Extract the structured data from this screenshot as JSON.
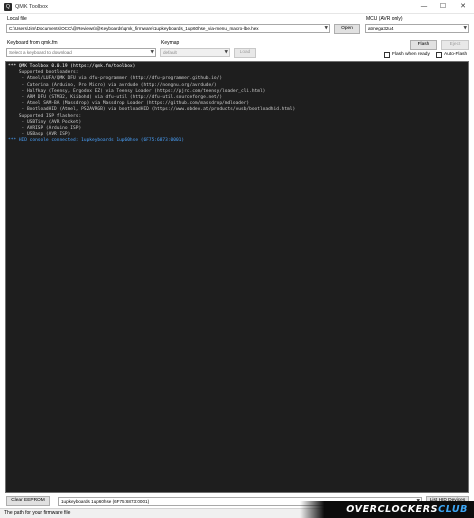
{
  "window": {
    "title": "QMK Toolbox",
    "icon_glyph": "Q",
    "controls": {
      "minimize": "—",
      "maximize": "☐",
      "close": "✕"
    }
  },
  "local_file": {
    "label": "Local file",
    "path": "C:\\Users\\Jim\\Documents\\OCC\\@Reviews\\@Keyboards\\qmk_firmware\\1upkeyboards_1up60hse_via-menu_macro-lbe.hex",
    "open_label": "Open"
  },
  "mcu": {
    "label": "MCU (AVR only)",
    "value": "atmega32u4",
    "flash_label": "Flash",
    "eject_label": "Eject",
    "flash_when_ready_label": "Flash when ready",
    "auto_flash_label": "Auto-Flash",
    "flash_when_ready_checked": false,
    "auto_flash_checked": false
  },
  "keyboard": {
    "label": "Keyboard from qmk.fm",
    "placeholder": "Select a keyboard to download",
    "keymap_label": "Keymap",
    "keymap_value": "default",
    "load_label": "Load"
  },
  "console": {
    "lines": [
      {
        "text": "*** QMK Toolbox 0.0.19 (https://qmk.fm/toolbox)",
        "color": "white"
      },
      {
        "text": "    Supported bootloaders:",
        "color": "grey"
      },
      {
        "text": "     - Atmel/LUFA/QMK DFU via dfu-programmer (http://dfu-programmer.github.io/)",
        "color": "grey"
      },
      {
        "text": "     - Caterina (Arduino, Pro Micro) via avrdude (http://nongnu.org/avrdude/)",
        "color": "grey"
      },
      {
        "text": "     - Halfkay (Teensy, Ergodox EZ) via Teensy Loader (https://pjrc.com/teensy/loader_cli.html)",
        "color": "grey"
      },
      {
        "text": "     - ARM DFU (STM32, Kiibohd) via dfu-util (http://dfu-util.sourceforge.net/)",
        "color": "grey"
      },
      {
        "text": "     - Atmel SAM-BA (Massdrop) via Massdrop Loader (https://github.com/massdrop/mdloader)",
        "color": "grey"
      },
      {
        "text": "     - BootloadHID (Atmel, PS2AVRGB) via bootloadHID (https://www.obdev.at/products/vusb/bootloadhid.html)",
        "color": "grey"
      },
      {
        "text": "    Supported ISP flashers:",
        "color": "grey"
      },
      {
        "text": "     - USBTiny (AVR Pocket)",
        "color": "grey"
      },
      {
        "text": "     - AVRISP (Arduino ISP)",
        "color": "grey"
      },
      {
        "text": "     - USBasp (AVR ISP)",
        "color": "grey"
      },
      {
        "text": "*** HID console connected: 1upkeyboards 1up60hse (6F75:6873:0001)",
        "color": "blue"
      }
    ]
  },
  "bottom": {
    "clear_eeprom_label": "Clear EEPROM",
    "hid_device_value": "1upkeyboards 1up60hse (6F75:6873:0001)",
    "list_hid_label": "List HID Devices"
  },
  "status": {
    "text": "The path for your firmware file"
  },
  "watermark": {
    "text_main": "OVERCLOCKERS",
    "text_accent": "CLUB"
  },
  "colors": {
    "console_bg": "#1e1e1e",
    "console_white": "#ffffff",
    "console_grey": "#cfcfcf",
    "console_blue": "#4aa3ff",
    "watermark_accent": "#3ea7f5"
  }
}
